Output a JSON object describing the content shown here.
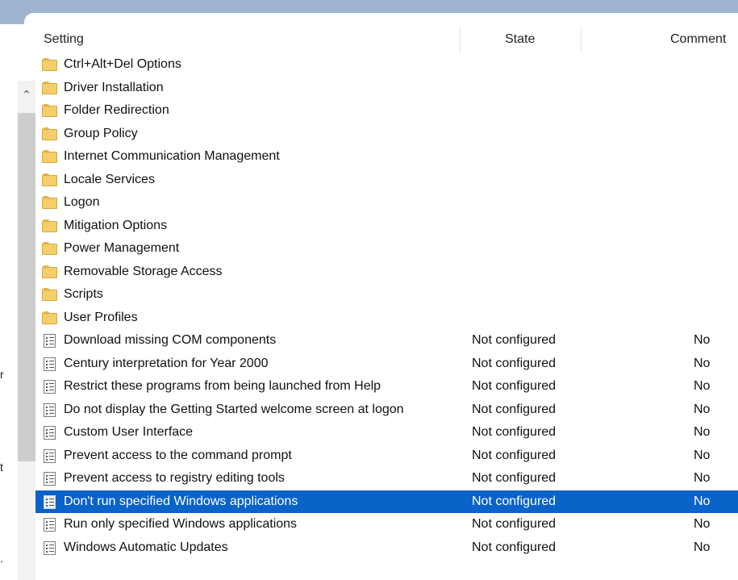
{
  "columns": {
    "setting": "Setting",
    "state": "State",
    "comment": "Comment"
  },
  "left_pane": {
    "fragments": [
      "r",
      "t",
      "."
    ]
  },
  "rows": [
    {
      "type": "folder",
      "name": "Ctrl+Alt+Del Options",
      "state": "",
      "comment": ""
    },
    {
      "type": "folder",
      "name": "Driver Installation",
      "state": "",
      "comment": ""
    },
    {
      "type": "folder",
      "name": "Folder Redirection",
      "state": "",
      "comment": ""
    },
    {
      "type": "folder",
      "name": "Group Policy",
      "state": "",
      "comment": ""
    },
    {
      "type": "folder",
      "name": "Internet Communication Management",
      "state": "",
      "comment": ""
    },
    {
      "type": "folder",
      "name": "Locale Services",
      "state": "",
      "comment": ""
    },
    {
      "type": "folder",
      "name": "Logon",
      "state": "",
      "comment": ""
    },
    {
      "type": "folder",
      "name": "Mitigation Options",
      "state": "",
      "comment": ""
    },
    {
      "type": "folder",
      "name": "Power Management",
      "state": "",
      "comment": ""
    },
    {
      "type": "folder",
      "name": "Removable Storage Access",
      "state": "",
      "comment": ""
    },
    {
      "type": "folder",
      "name": "Scripts",
      "state": "",
      "comment": ""
    },
    {
      "type": "folder",
      "name": "User Profiles",
      "state": "",
      "comment": ""
    },
    {
      "type": "setting",
      "name": "Download missing COM components",
      "state": "Not configured",
      "comment": "No"
    },
    {
      "type": "setting",
      "name": "Century interpretation for Year 2000",
      "state": "Not configured",
      "comment": "No"
    },
    {
      "type": "setting",
      "name": "Restrict these programs from being launched from Help",
      "state": "Not configured",
      "comment": "No"
    },
    {
      "type": "setting",
      "name": "Do not display the Getting Started welcome screen at logon",
      "state": "Not configured",
      "comment": "No"
    },
    {
      "type": "setting",
      "name": "Custom User Interface",
      "state": "Not configured",
      "comment": "No"
    },
    {
      "type": "setting",
      "name": "Prevent access to the command prompt",
      "state": "Not configured",
      "comment": "No"
    },
    {
      "type": "setting",
      "name": "Prevent access to registry editing tools",
      "state": "Not configured",
      "comment": "No"
    },
    {
      "type": "setting",
      "name": "Don't run specified Windows applications",
      "state": "Not configured",
      "comment": "No",
      "selected": true
    },
    {
      "type": "setting",
      "name": "Run only specified Windows applications",
      "state": "Not configured",
      "comment": "No"
    },
    {
      "type": "setting",
      "name": "Windows Automatic Updates",
      "state": "Not configured",
      "comment": "No"
    }
  ],
  "colors": {
    "selection": "#0a63c8",
    "folder": "#f2cf6a",
    "title_strip": "#9fb4d1"
  },
  "icons": {
    "folder": "folder-icon",
    "setting": "policy-setting-icon",
    "scroll_up": "chevron-up-icon"
  }
}
